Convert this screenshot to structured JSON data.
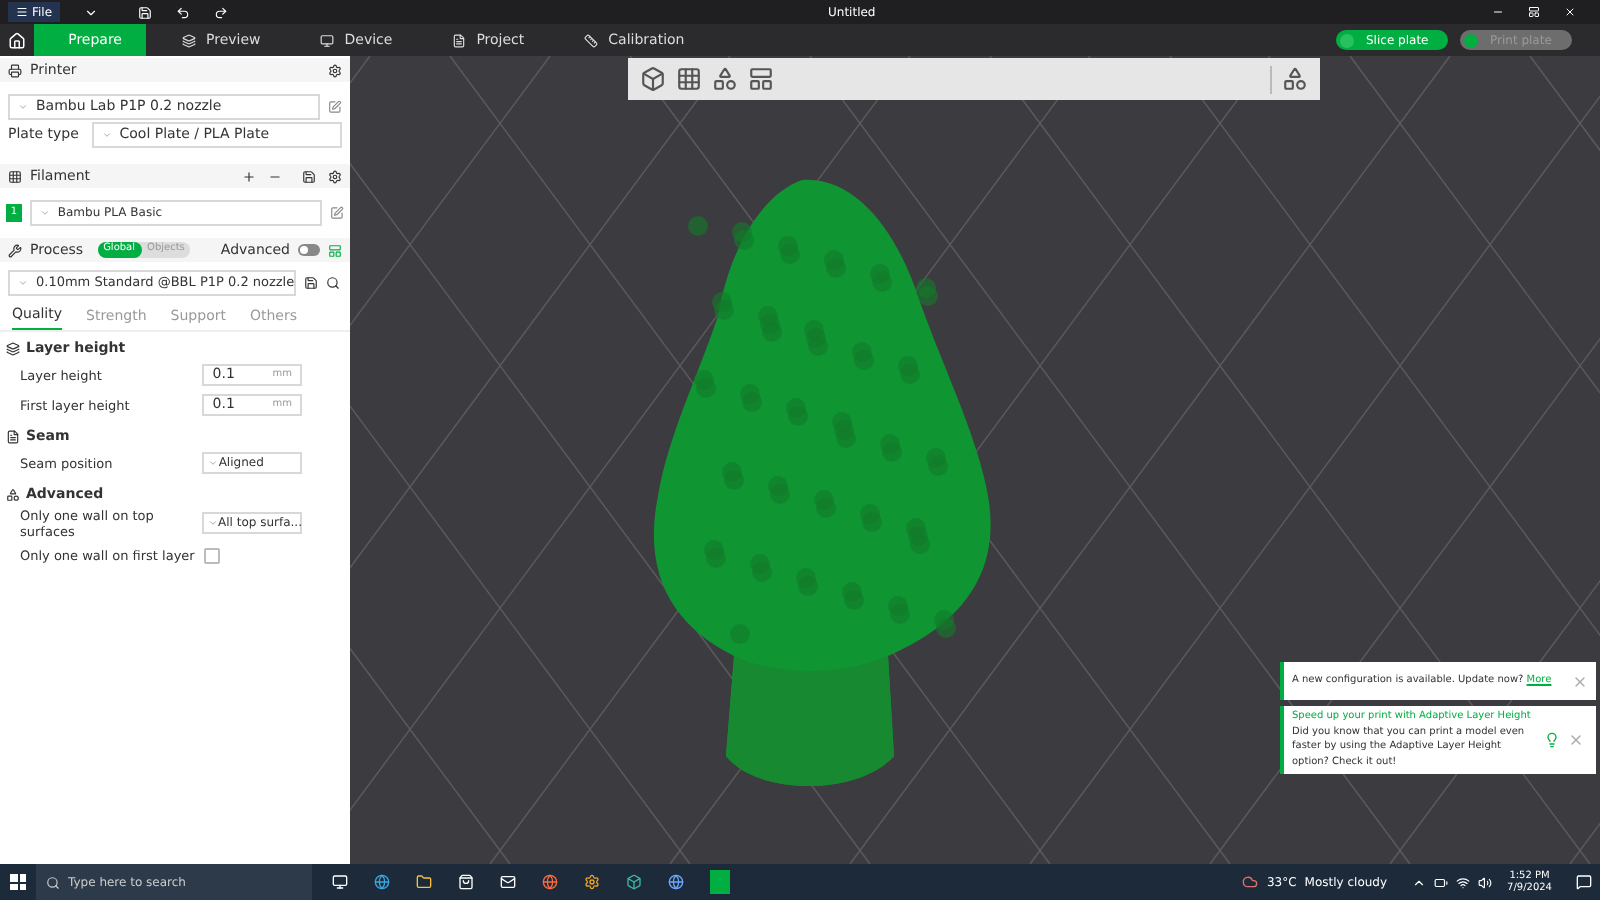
{
  "window": {
    "menu": "File",
    "title": "Untitled"
  },
  "tabs": [
    {
      "label": "Prepare",
      "selected": true
    },
    {
      "label": "Preview",
      "selected": false
    },
    {
      "label": "Device",
      "selected": false
    },
    {
      "label": "Project",
      "selected": false
    },
    {
      "label": "Calibration",
      "selected": false
    }
  ],
  "actions": [
    {
      "label": "Slice plate",
      "disabled": false
    },
    {
      "label": "Print plate",
      "disabled": true
    }
  ],
  "printer": {
    "title": "Printer",
    "preset": "Bambu Lab P1P 0.2 nozzle",
    "plate_type_label": "Plate type",
    "plate_type": "Cool Plate / PLA Plate"
  },
  "filament": {
    "title": "Filament",
    "items": [
      {
        "index": "1",
        "name": "Bambu PLA Basic",
        "color": "#00ae42"
      }
    ]
  },
  "process": {
    "title": "Process",
    "scopes": [
      {
        "label": "Global",
        "selected": true
      },
      {
        "label": "Objects",
        "selected": false
      }
    ],
    "advanced_label": "Advanced",
    "advanced_on": false,
    "preset": "0.10mm Standard @BBL P1P 0.2 nozzle",
    "tabs": [
      {
        "label": "Quality",
        "selected": true
      },
      {
        "label": "Strength",
        "selected": false
      },
      {
        "label": "Support",
        "selected": false
      },
      {
        "label": "Others",
        "selected": false
      }
    ]
  },
  "groups": [
    {
      "title": "Layer height",
      "rows": [
        {
          "kind": "number",
          "label": "Layer height",
          "value": "0.1",
          "unit": "mm"
        },
        {
          "kind": "number",
          "label": "First layer height",
          "value": "0.1",
          "unit": "mm"
        }
      ]
    },
    {
      "title": "Seam",
      "rows": [
        {
          "kind": "select",
          "label": "Seam position",
          "value": "Aligned"
        }
      ]
    },
    {
      "title": "Advanced",
      "rows": [
        {
          "kind": "select",
          "label": "Only one wall on top surfaces",
          "value": "All top surfa..."
        },
        {
          "kind": "checkbox",
          "label": "Only one wall on first layer",
          "checked": false
        }
      ]
    }
  ],
  "notifications": [
    {
      "text": "A new configuration is available. Update now?",
      "link": "More"
    },
    {
      "title": "Speed up your print with Adaptive Layer Height",
      "text": "Did you know that you can print a model even faster by using the Adaptive Layer Height option? Check it out!"
    }
  ],
  "taskbar": {
    "search_placeholder": "Type here to search",
    "temperature": "33°C",
    "weather": "Mostly cloudy",
    "time": "1:52 PM",
    "date": "7/9/2024"
  }
}
